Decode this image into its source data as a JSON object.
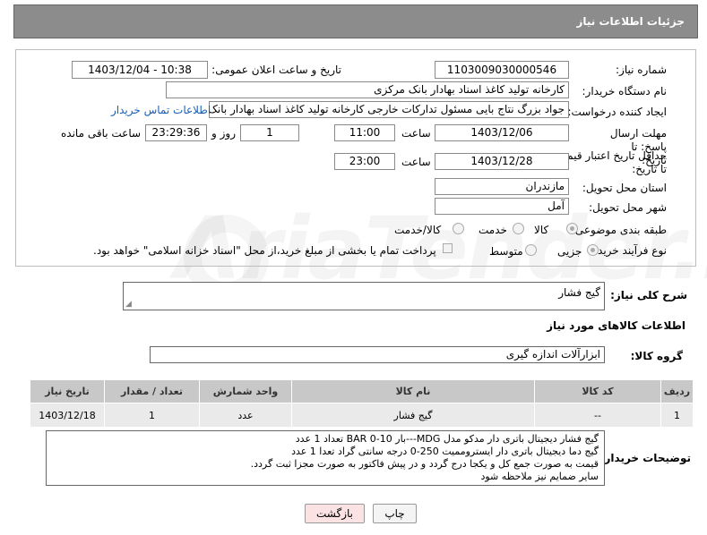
{
  "header": {
    "title": "جزئیات اطلاعات نیاز"
  },
  "watermark": "AriaTender.neT",
  "fields": {
    "need_number_label": "شماره نیاز:",
    "need_number": "1103009030000546",
    "announce_label": "تاریخ و ساعت اعلان عمومی:",
    "announce_value": "1403/12/04 - 10:38",
    "buyer_org_label": "نام دستگاه خریدار:",
    "buyer_org": "کارخانه تولید کاغذ اسناد بهادار بانک مرکزی",
    "creator_label": "ایجاد کننده درخواست:",
    "creator": "جواد بزرگ نتاج بایی مسئول تدارکات خارجی کارخانه تولید کاغذ اسناد بهادار بانک",
    "contact_link": "اطلاعات تماس خریدار",
    "deadline_label": "مهلت ارسال پاسخ: تا تاریخ:",
    "deadline_date": "1403/12/06",
    "time_label": "ساعت",
    "deadline_time": "11:00",
    "days_value": "1",
    "days_label": "روز و",
    "remaining_value": "23:29:36",
    "remaining_label": "ساعت باقی مانده",
    "validity_label": "حداقل تاریخ اعتبار قیمت: تا تاریخ:",
    "validity_date": "1403/12/28",
    "validity_time": "23:00",
    "province_label": "استان محل تحویل:",
    "province": "مازندران",
    "city_label": "شهر محل تحویل:",
    "city": "آمل",
    "category_label": "طبقه بندی موضوعی:",
    "category_options": [
      "کالا",
      "خدمت",
      "کالا/خدمت"
    ],
    "process_label": "نوع فرآیند خرید :",
    "process_options": [
      "جزیی",
      "متوسط"
    ],
    "payment_note": "پرداخت تمام یا بخشی از مبلغ خرید،از محل \"اسناد خزانه اسلامی\" خواهد بود."
  },
  "summary": {
    "label": "شرح کلی نیاز:",
    "value": "گیج فشار"
  },
  "goods_info_title": "اطلاعات کالاهای مورد نیاز",
  "goods_group": {
    "label": "گروه کالا:",
    "value": "ابزارآلات اندازه گیری"
  },
  "table": {
    "headers": [
      "ردیف",
      "کد کالا",
      "نام کالا",
      "واحد شمارش",
      "تعداد / مقدار",
      "تاریخ نیاز"
    ],
    "rows": [
      [
        "1",
        "--",
        "گیج فشار",
        "عدد",
        "1",
        "1403/12/18"
      ]
    ]
  },
  "buyer_notes": {
    "label": "توضیحات خریدار:",
    "lines": [
      "گیج فشار دیجیتال باتری دار مدکو مدل MDG---بار BAR 0-10 تعداد 1 عدد",
      "گیج دما دیجیتال باتری دار ایستروممیت   250-0 درجه سانتی گراد تعدا 1 عدد",
      "قیمت به صورت جمع کل و یکجا درج گردد و در پیش فاکتور به صورت مجزا ثبت گردد.",
      "سایر ضمایم نیز ملاحظه شود"
    ]
  },
  "buttons": {
    "print": "چاپ",
    "back": "بازگشت"
  },
  "colors": {
    "header_bg": "#8c8c8c",
    "link": "#1a5fb4",
    "back_button_bg": "#fbe3e3",
    "table_header_bg": "#c8c8c8"
  }
}
